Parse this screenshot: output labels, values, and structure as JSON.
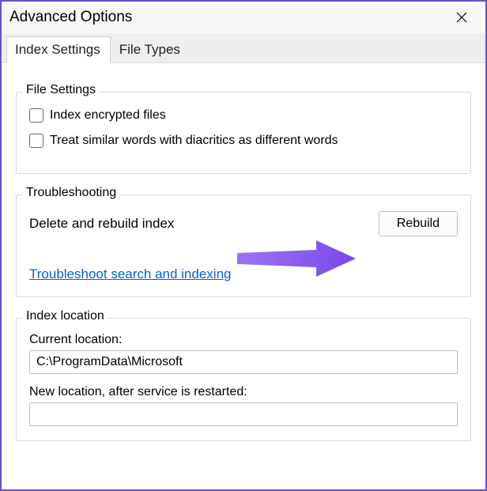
{
  "window": {
    "title": "Advanced Options"
  },
  "tabs": {
    "items": [
      {
        "label": "Index Settings",
        "active": true
      },
      {
        "label": "File Types",
        "active": false
      }
    ]
  },
  "file_settings": {
    "title": "File Settings",
    "opt_encrypted": "Index encrypted files",
    "opt_diacritics": "Treat similar words with diacritics as different words"
  },
  "troubleshooting": {
    "title": "Troubleshooting",
    "delete_rebuild_label": "Delete and rebuild index",
    "rebuild_button": "Rebuild",
    "link_text": "Troubleshoot search and indexing"
  },
  "index_location": {
    "title": "Index location",
    "current_label": "Current location:",
    "current_value": "C:\\ProgramData\\Microsoft",
    "new_label": "New location, after service is restarted:"
  },
  "annotation": {
    "arrow_color": "#8a5cf0"
  }
}
